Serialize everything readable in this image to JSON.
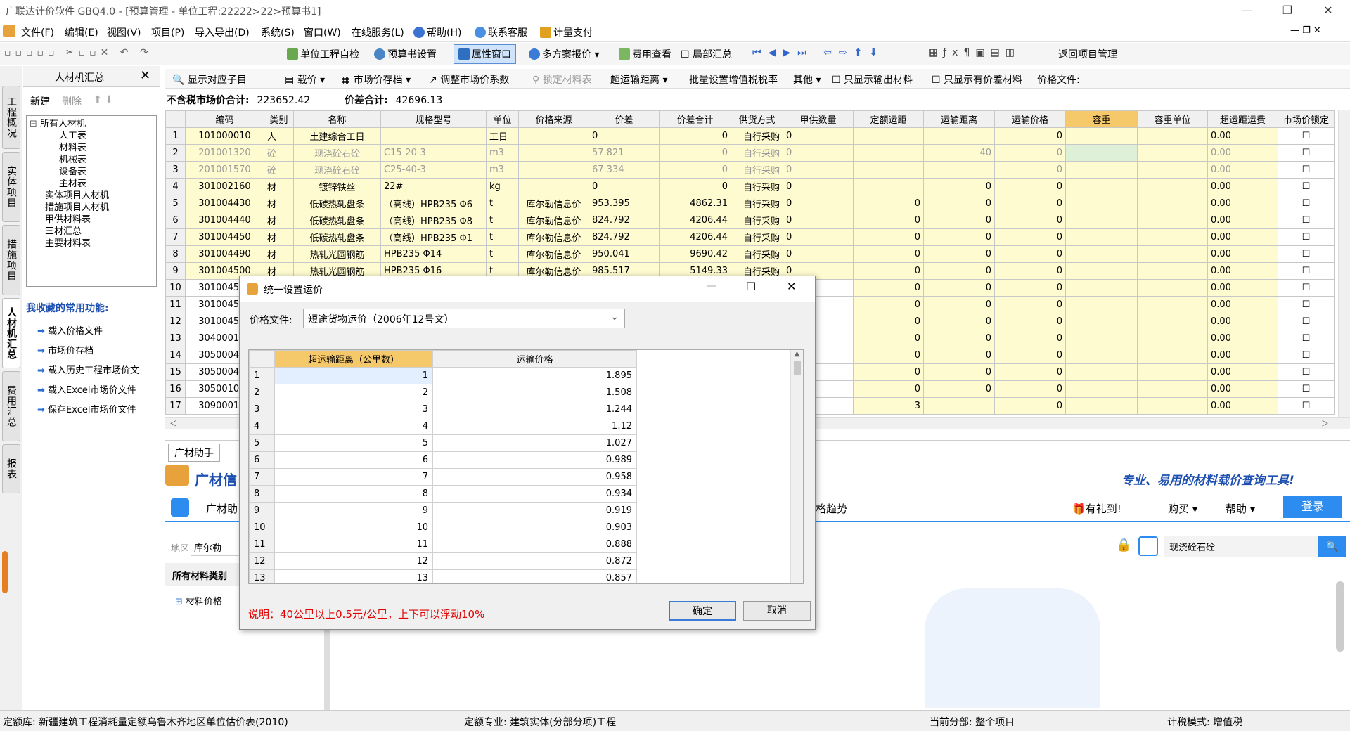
{
  "window": {
    "title": "广联达计价软件 GBQ4.0 - [预算管理 - 单位工程:22222>22>预算书1]"
  },
  "menu": [
    "文件(F)",
    "编辑(E)",
    "视图(V)",
    "项目(P)",
    "导入导出(D)",
    "系统(S)",
    "窗口(W)",
    "在线服务(L)",
    "帮助(H)",
    "联系客服",
    "计量支付"
  ],
  "toolbar1": {
    "unit_check": "单位工程自检",
    "budget_settings": "预算书设置",
    "property_window": "属性窗口",
    "multi_quote": "多方案报价",
    "fee_view": "费用查看",
    "partial_summary": "局部汇总",
    "return_project": "返回项目管理"
  },
  "toolbar2": {
    "show_corresponding": "显示对应子目",
    "load_price": "载价",
    "market_price_save": "市场价存档",
    "adjust_coef": "调整市场价系数",
    "lock_material": "锁定材料表",
    "over_distance": "超运输距离",
    "batch_vat": "批量设置增值税税率",
    "others": "其他",
    "only_output": "只显示输出材料",
    "only_diff": "只显示有价差材料",
    "price_file_label": "价格文件:"
  },
  "lefttabs": [
    "工程概况",
    "实体项目",
    "措施项目",
    "人材机汇总",
    "费用汇总",
    "报表"
  ],
  "leftpanel": {
    "title": "人材机汇总",
    "new_label": "新建",
    "delete_label": "删除",
    "tree": [
      {
        "label": "所有人材机",
        "level": 0
      },
      {
        "label": "人工表",
        "level": 1
      },
      {
        "label": "材料表",
        "level": 1
      },
      {
        "label": "机械表",
        "level": 1
      },
      {
        "label": "设备表",
        "level": 1
      },
      {
        "label": "主材表",
        "level": 1
      },
      {
        "label": "实体项目人材机",
        "level": 0
      },
      {
        "label": "措施项目人材机",
        "level": 0
      },
      {
        "label": "甲供材料表",
        "level": 0
      },
      {
        "label": "三材汇总",
        "level": 0
      },
      {
        "label": "主要材料表",
        "level": 0
      }
    ],
    "fav_title": "我收藏的常用功能:",
    "favorites": [
      "载入价格文件",
      "市场价存档",
      "载入历史工程市场价文",
      "载入Excel市场价文件",
      "保存Excel市场价文件"
    ]
  },
  "summary": {
    "non_tax_label": "不含税市场价合计:",
    "non_tax_value": "223652.42",
    "diff_label": "价差合计:",
    "diff_value": "42696.13"
  },
  "grid": {
    "columns": [
      "编码",
      "类别",
      "名称",
      "规格型号",
      "单位",
      "价格来源",
      "价差",
      "价差合计",
      "供货方式",
      "甲供数量",
      "定额运距",
      "运输距离",
      "运输价格",
      "容重",
      "容重单位",
      "超运距运费",
      "市场价锁定"
    ],
    "rows": [
      [
        "1",
        "101000010",
        "人",
        "土建综合工日",
        "",
        "工日",
        "",
        "0",
        "0",
        "自行采购",
        "0",
        "",
        "",
        "0",
        "",
        "",
        "0.00"
      ],
      [
        "2",
        "201001320",
        "砼",
        "现浇砼石砼",
        "C15-20-3",
        "m3",
        "",
        "57.821",
        "0",
        "自行采购",
        "0",
        "",
        "40",
        "0",
        "",
        "",
        "0.00"
      ],
      [
        "3",
        "201001570",
        "砼",
        "现浇砼石砼",
        "C25-40-3",
        "m3",
        "",
        "67.334",
        "0",
        "自行采购",
        "0",
        "",
        "",
        "0",
        "",
        "",
        "0.00"
      ],
      [
        "4",
        "301002160",
        "材",
        "镀锌铁丝",
        "22#",
        "kg",
        "",
        "0",
        "0",
        "自行采购",
        "0",
        "",
        "0",
        "0",
        "",
        "",
        "0.00"
      ],
      [
        "5",
        "301004430",
        "材",
        "低碳热轧盘条",
        "（高线）HPB235 Φ6",
        "t",
        "库尔勒信息价",
        "953.395",
        "4862.31",
        "自行采购",
        "0",
        "0",
        "0",
        "0",
        "",
        "",
        "0.00"
      ],
      [
        "6",
        "301004440",
        "材",
        "低碳热轧盘条",
        "（高线）HPB235 Φ8",
        "t",
        "库尔勒信息价",
        "824.792",
        "4206.44",
        "自行采购",
        "0",
        "0",
        "0",
        "0",
        "",
        "",
        "0.00"
      ],
      [
        "7",
        "301004450",
        "材",
        "低碳热轧盘条",
        "（高线）HPB235 Φ1",
        "t",
        "库尔勒信息价",
        "824.792",
        "4206.44",
        "自行采购",
        "0",
        "0",
        "0",
        "0",
        "",
        "",
        "0.00"
      ],
      [
        "8",
        "301004490",
        "材",
        "热轧光圆钢筋",
        "HPB235 Φ14",
        "t",
        "库尔勒信息价",
        "950.041",
        "9690.42",
        "自行采购",
        "0",
        "0",
        "0",
        "0",
        "",
        "",
        "0.00"
      ],
      [
        "9",
        "301004500",
        "材",
        "热轧光圆钢筋",
        "HPB235 Φ16",
        "t",
        "库尔勒信息价",
        "985.517",
        "5149.33",
        "自行采购",
        "0",
        "0",
        "0",
        "0",
        "",
        "",
        "0.00"
      ],
      [
        "10",
        "301004510",
        "",
        "",
        "",
        "",
        "",
        "",
        "",
        "",
        "0",
        "0",
        "0",
        "0",
        "",
        "",
        "0.00"
      ],
      [
        "11",
        "301004520",
        "",
        "",
        "",
        "",
        "",
        "",
        "",
        "",
        "0",
        "0",
        "0",
        "0",
        "",
        "",
        "0.00"
      ],
      [
        "12",
        "301004530",
        "",
        "",
        "",
        "",
        "",
        "",
        "",
        "",
        "0",
        "0",
        "0",
        "0",
        "",
        "",
        "0.00"
      ],
      [
        "13",
        "304000190",
        "",
        "",
        "",
        "",
        "",
        "",
        "",
        "",
        "0",
        "0",
        "0",
        "0",
        "",
        "",
        "0.00"
      ],
      [
        "14",
        "305000400",
        "",
        "",
        "",
        "",
        "",
        "",
        "",
        "",
        "0",
        "0",
        "0",
        "0",
        "",
        "",
        "0.00"
      ],
      [
        "15",
        "305000420",
        "",
        "",
        "",
        "",
        "",
        "",
        "",
        "",
        "0",
        "0",
        "0",
        "0",
        "",
        "",
        "0.00"
      ],
      [
        "16",
        "305001000",
        "",
        "",
        "",
        "",
        "",
        "",
        "",
        "",
        "0",
        "0",
        "0",
        "0",
        "",
        "",
        "0.00"
      ],
      [
        "17",
        "309000100",
        "",
        "",
        "",
        "",
        "",
        "",
        "",
        "",
        "0",
        "3",
        "",
        "0",
        "",
        "",
        "0.00"
      ]
    ]
  },
  "bottom": {
    "tab": "广材助手",
    "brand": "广材信",
    "brand_sub": "广材助",
    "slogan": "专业、易用的材料载价查询工具!",
    "trend": "格趋势",
    "gift": "有礼到!",
    "buy": "购买",
    "help": "帮助",
    "login": "登录",
    "region_label": "地区",
    "region_value": "库尔勒",
    "search_value": "现浇砼石砼",
    "category_title": "所有材料类别",
    "category_item": "材料价格"
  },
  "dialog": {
    "title": "统一设置运价",
    "price_file_label": "价格文件:",
    "price_file_value": "短途货物运价（2006年12号文）",
    "columns": [
      "超运输距离（公里数）",
      "运输价格"
    ],
    "rows": [
      [
        "1",
        "1",
        "1.895"
      ],
      [
        "2",
        "2",
        "1.508"
      ],
      [
        "3",
        "3",
        "1.244"
      ],
      [
        "4",
        "4",
        "1.12"
      ],
      [
        "5",
        "5",
        "1.027"
      ],
      [
        "6",
        "6",
        "0.989"
      ],
      [
        "7",
        "7",
        "0.958"
      ],
      [
        "8",
        "8",
        "0.934"
      ],
      [
        "9",
        "9",
        "0.919"
      ],
      [
        "10",
        "10",
        "0.903"
      ],
      [
        "11",
        "11",
        "0.888"
      ],
      [
        "12",
        "12",
        "0.872"
      ],
      [
        "13",
        "13",
        "0.857"
      ]
    ],
    "note": "说明：40公里以上0.5元/公里，上下可以浮动10%",
    "ok": "确定",
    "cancel": "取消"
  },
  "status": {
    "quota_lib": "定额库:  新疆建筑工程消耗量定额乌鲁木齐地区单位估价表(2010)",
    "quota_major": "定额专业:  建筑实体(分部分项)工程",
    "current_part": "当前分部:  整个项目",
    "tax_mode": "计税模式:  增值税"
  },
  "colors": {
    "highlight": "#fffbd0",
    "header_bg": "#f0f0f0",
    "note_red": "#e00000",
    "link_blue": "#1560bd",
    "accent": "#2d8cf0"
  }
}
